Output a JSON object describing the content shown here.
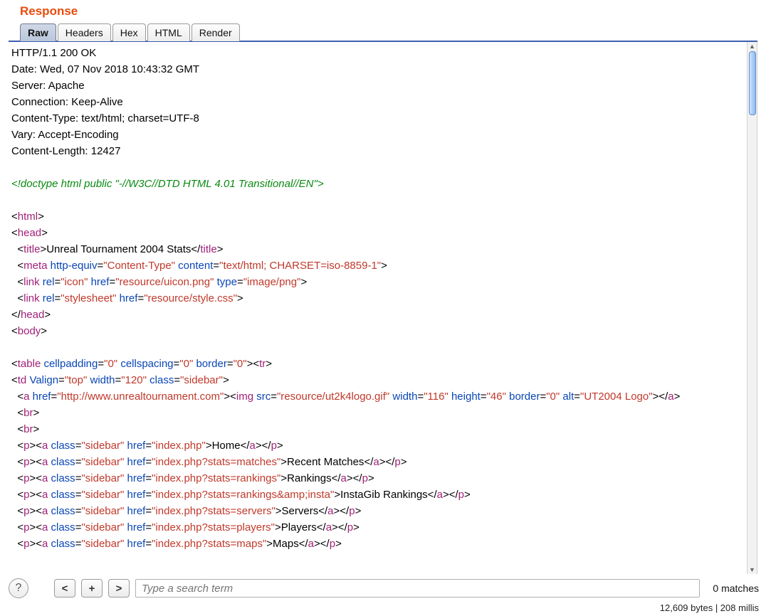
{
  "title": "Response",
  "tabs": {
    "raw": "Raw",
    "headers": "Headers",
    "hex": "Hex",
    "html": "HTML",
    "render": "Render"
  },
  "headers_block": {
    "status": "HTTP/1.1 200 OK",
    "date": "Date: Wed, 07 Nov 2018 10:43:32 GMT",
    "server": "Server: Apache",
    "connection": "Connection: Keep-Alive",
    "ctype": "Content-Type: text/html; charset=UTF-8",
    "vary": "Vary: Accept-Encoding",
    "clen": "Content-Length: 12427"
  },
  "body": {
    "doctype": "<!doctype html public \"-//W3C//DTD HTML 4.01 Transitional//EN\">",
    "title_text": "Unreal Tournament 2004 Stats",
    "meta_httpequiv": "Content-Type",
    "meta_content": "text/html; CHARSET=iso-8859-1",
    "link_icon_rel": "icon",
    "link_icon_href": "resource/uicon.png",
    "link_icon_type": "image/png",
    "link_css_rel": "stylesheet",
    "link_css_href": "resource/style.css",
    "table_cellpadding": "0",
    "table_cellspacing": "0",
    "table_border": "0",
    "td_valign": "top",
    "td_width": "120",
    "td_class": "sidebar",
    "a_href": "http://www.unrealtournament.com",
    "img_src": "resource/ut2k4logo.gif",
    "img_w": "116",
    "img_h": "46",
    "img_border": "0",
    "img_alt": "UT2004 Logo",
    "links": [
      {
        "href": "index.php",
        "text": "Home"
      },
      {
        "href": "index.php?stats=matches",
        "text": "Recent Matches"
      },
      {
        "href": "index.php?stats=rankings",
        "text": "Rankings"
      },
      {
        "href": "index.php?stats=rankings&amp;insta",
        "text": "InstaGib Rankings"
      },
      {
        "href": "index.php?stats=servers",
        "text": "Servers"
      },
      {
        "href": "index.php?stats=players",
        "text": "Players"
      },
      {
        "href": "index.php?stats=maps",
        "text": "Maps"
      }
    ],
    "sidebar_class": "sidebar"
  },
  "search": {
    "placeholder": "Type a search term",
    "matches": "0 matches"
  },
  "status": "12,609 bytes | 208 millis"
}
